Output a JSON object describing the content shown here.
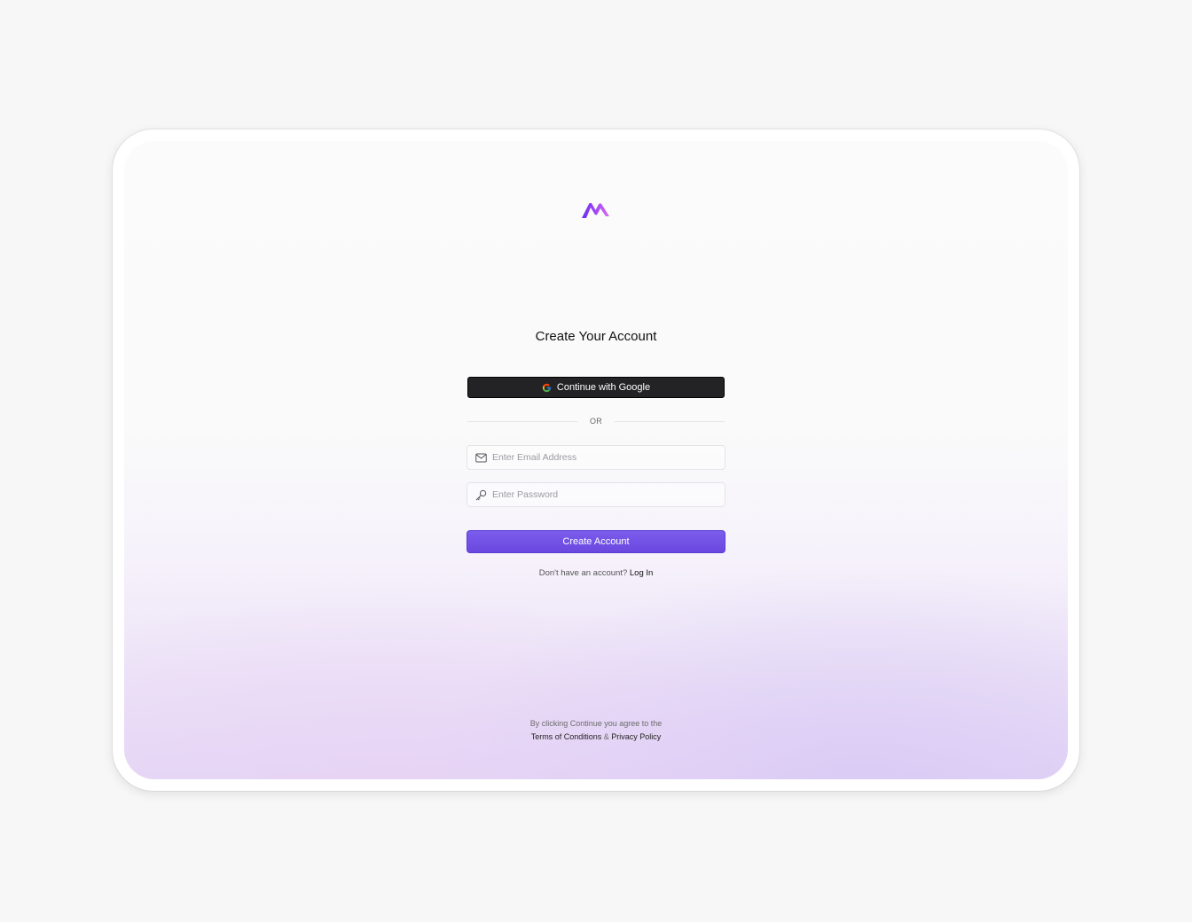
{
  "brand": {
    "logo_icon": "brand-m-wave-logo",
    "colors": [
      "#6a2cf0",
      "#b04cf5",
      "#d96cf0"
    ]
  },
  "page": {
    "title": "Create Your Account"
  },
  "google_button": {
    "label": "Continue with Google",
    "icon": "google-g-icon"
  },
  "divider": {
    "label": "OR"
  },
  "email_field": {
    "placeholder": "Enter Email Address",
    "value": "",
    "icon": "mail-icon"
  },
  "password_field": {
    "placeholder": "Enter Password",
    "value": "",
    "icon": "key-icon"
  },
  "create_button": {
    "label": "Create Account",
    "color": "#6d4ce6"
  },
  "login_prompt": {
    "text": "Don't have an account?",
    "link_label": "Log In"
  },
  "legal": {
    "line1": "By clicking Continue you agree to the",
    "terms_label": "Terms of Conditions",
    "separator": "&",
    "privacy_label": "Privacy Policy"
  }
}
